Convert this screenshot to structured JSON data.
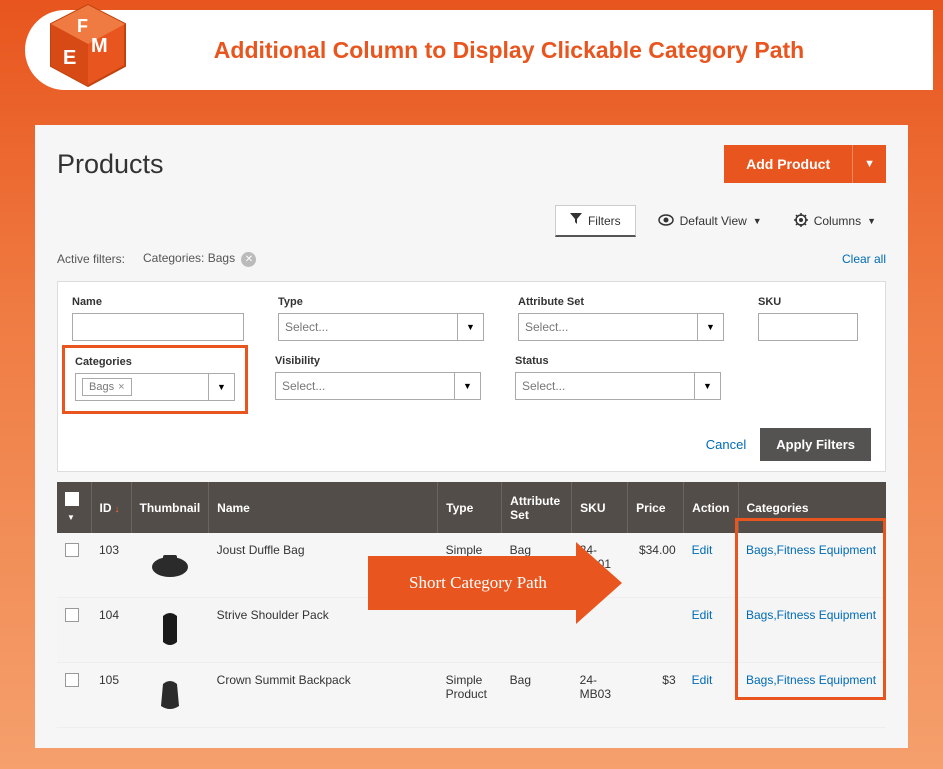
{
  "header": {
    "title": "Additional Column to Display Clickable Category Path"
  },
  "page": {
    "title": "Products"
  },
  "buttons": {
    "add_product": "Add Product",
    "filters": "Filters",
    "default_view": "Default View",
    "columns": "Columns",
    "cancel": "Cancel",
    "apply": "Apply Filters",
    "clear_all": "Clear all"
  },
  "active_filters": {
    "label": "Active filters:",
    "chip_label": "Categories:",
    "chip_value": "Bags"
  },
  "filters": {
    "name": {
      "label": "Name"
    },
    "type": {
      "label": "Type",
      "placeholder": "Select..."
    },
    "attribute_set": {
      "label": "Attribute Set",
      "placeholder": "Select..."
    },
    "sku": {
      "label": "SKU"
    },
    "categories": {
      "label": "Categories",
      "tag": "Bags"
    },
    "visibility": {
      "label": "Visibility",
      "placeholder": "Select..."
    },
    "status": {
      "label": "Status",
      "placeholder": "Select..."
    }
  },
  "table": {
    "headers": {
      "id": "ID",
      "thumbnail": "Thumbnail",
      "name": "Name",
      "type": "Type",
      "attribute_set": "Attribute Set",
      "sku": "SKU",
      "price": "Price",
      "action": "Action",
      "categories": "Categories"
    },
    "rows": [
      {
        "id": "103",
        "name": "Joust Duffle Bag",
        "type": "Simple Product",
        "aset": "Bag",
        "sku": "24-MB01",
        "price": "$34.00",
        "action": "Edit",
        "categories": "Bags,Fitness Equipment"
      },
      {
        "id": "104",
        "name": "Strive Shoulder Pack",
        "type": "",
        "aset": "",
        "sku": "",
        "price": "",
        "action": "Edit",
        "categories": "Bags,Fitness Equipment"
      },
      {
        "id": "105",
        "name": "Crown Summit Backpack",
        "type": "Simple Product",
        "aset": "Bag",
        "sku": "24-MB03",
        "price": "$3",
        "action": "Edit",
        "categories": "Bags,Fitness Equipment"
      }
    ]
  },
  "callout": {
    "text": "Short Category Path"
  }
}
